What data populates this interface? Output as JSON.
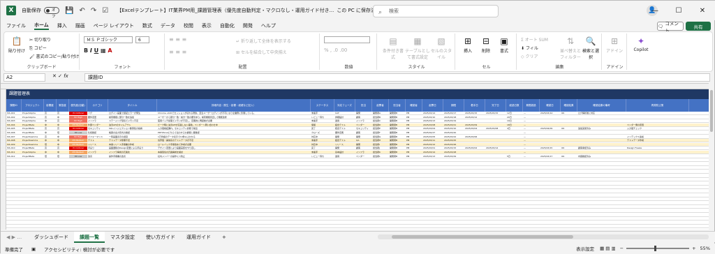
{
  "titlebar": {
    "autosave_label": "自動保存",
    "autosave_state": "オフ",
    "doc_title": "【Excelテンプレート】IT業界PM用_課題管理表（優先度自動判定・マクロなし・運用ガイド付き...",
    "save_location": "この PC に保存済み",
    "search_placeholder": "検索",
    "minimize": "—",
    "maximize": "☐",
    "close": "✕"
  },
  "menu": {
    "items": [
      "ファイル",
      "ホーム",
      "挿入",
      "描画",
      "ページ レイアウト",
      "数式",
      "データ",
      "校閲",
      "表示",
      "自動化",
      "開発",
      "ヘルプ"
    ],
    "active": "ホーム",
    "comment": "コメント",
    "share": "共有"
  },
  "ribbon": {
    "clipboard": {
      "paste": "貼り付け",
      "cut": "切り取り",
      "copy": "コピー",
      "format_painter": "書式のコピー/貼り付け",
      "label": "クリップボード"
    },
    "font": {
      "name": "ＭＳ Ｐゴシック",
      "size": "6",
      "label": "フォント"
    },
    "alignment": {
      "wrap": "折り返して全体を表示する",
      "merge": "セルを結合して中央揃え",
      "label": "配置"
    },
    "number": {
      "label": "数値"
    },
    "styles": {
      "conditional": "条件付き書式",
      "table": "テーブルとして書式設定",
      "cell": "セルのスタイル",
      "label": "スタイル"
    },
    "cells": {
      "insert": "挿入",
      "delete": "削除",
      "format": "書式",
      "label": "セル"
    },
    "editing": {
      "autosum": "オート SUM",
      "fill": "フィル",
      "clear": "クリア",
      "sort": "並べ替えとフィルター",
      "find": "検索と選択",
      "label": "編集"
    },
    "addins": {
      "label": "アドイン",
      "addin": "アドイン"
    },
    "copilot": "Copilot"
  },
  "formula": {
    "cell": "A2",
    "fx": "fx",
    "value": "課題ID"
  },
  "sheet": {
    "title": "課題管理表",
    "headers": [
      "課題ID",
      "プロジェクト",
      "影響度",
      "緊急度",
      "優先度(自動)",
      "カテゴリ",
      "タイトル",
      "詳細内容（発生・影響・経緯など記入）",
      "ステータス",
      "対応フェーズ",
      "担当",
      "起票者",
      "担当者",
      "確認者",
      "起票日",
      "期限",
      "着手日",
      "完了日",
      "経過日数",
      "期限超過",
      "確認日",
      "確認結果",
      "確認結果の備考",
      "再発防止策"
    ],
    "rows": [
      {
        "id": "ISS-001",
        "proj": "ProjectAlpha",
        "impact": "高",
        "urgency": "高",
        "prio": "P1 Critical",
        "pcolor": "#e00000",
        "cat": "バグ",
        "title": "ログイン画面で認証エラーが発生",
        "detail": "Chrome v120でセッションが切れる現象。至急ユーザーログインが不可になり全業務に影響している。",
        "status": "未着手",
        "phase": "UAT",
        "dept": "開発",
        "owner": "開発者A",
        "reporter": "開発者B",
        "checker": "PM",
        "date": "2025/03/14",
        "due": "2025/03/17",
        "start": "2025/03/15",
        "done": "2025/03/15",
        "days": "12日",
        "over": "—",
        "cdate": "2025/03/14",
        "cres": "OK",
        "cnote": "ログ解析後に対応",
        "prev": ""
      },
      {
        "id": "ISS-002",
        "proj": "ProjectAlpha",
        "impact": "高",
        "urgency": "中",
        "prio": "P2 High",
        "pcolor": "#f07060",
        "cat": "要件変更",
        "title": "検索機能に部分一致を追加",
        "detail": "ユーザーから部分一致・前方一致の要望あり。検索機能見直しで機能改修",
        "status": "レビュー待ち",
        "phase": "詳細設計",
        "dept": "顧客",
        "owner": "担当者B",
        "reporter": "開発者B",
        "checker": "PM",
        "date": "2025/03/10",
        "due": "2025/03/18",
        "start": "2025/03/12",
        "done": "",
        "days": "20日",
        "over": "—",
        "cdate": "",
        "cres": "",
        "cnote": "",
        "prev": ""
      },
      {
        "id": "ISS-003",
        "proj": "ProjectAlpha",
        "impact": "中",
        "urgency": "高",
        "prio": "P2 High",
        "pcolor": "#f07060",
        "cat": "インフラ",
        "title": "ステージング環境でメモリ不足",
        "detail": "夜間バッチ処理でメモリが不足し、定期的に再起動が必要",
        "status": "未着手",
        "phase": "運用",
        "dept": "インフラ",
        "owner": "担当者C",
        "reporter": "開発者B",
        "checker": "PM",
        "date": "2025/03/13",
        "due": "2025/03/19",
        "start": "",
        "done": "",
        "days": "19日",
        "over": "—",
        "cdate": "",
        "cres": "",
        "cnote": "",
        "prev": ""
      },
      {
        "id": "ISS-004",
        "proj": "ProjectBeta",
        "impact": "中",
        "urgency": "中",
        "prio": "P3 Medium",
        "pcolor": "#f4a460",
        "cat": "外部ベンダー",
        "title": "決済APIのタイムアウト",
        "detail": "ピーク時に決済APIが応答しない事象。ベンダーへ問い合わせ中",
        "status": "保留",
        "phase": "結合テスト",
        "dept": "ベンダー",
        "owner": "担当者D",
        "reporter": "開発者B",
        "checker": "PM",
        "date": "2025/03/08",
        "due": "2025/03/21",
        "start": "2025/03/09",
        "done": "",
        "days": "18日",
        "over": "—",
        "cdate": "",
        "cres": "",
        "cnote": "",
        "prev": "ベンダー側の原因"
      },
      {
        "id": "ISS-005",
        "proj": "ProjectBeta",
        "impact": "高",
        "urgency": "高",
        "prio": "P1 Critical",
        "pcolor": "#e00000",
        "cat": "セキュリティ",
        "title": "SQLインジェクション脆弱性の指摘",
        "detail": "入力値検証漏れ。セキュリティ診断で検出",
        "status": "完了",
        "phase": "統合テスト",
        "dept": "セキュリティ",
        "owner": "担当者E",
        "reporter": "開発者B",
        "checker": "PM",
        "date": "2025/03/04",
        "due": "2025/03/10",
        "start": "2025/03/04",
        "done": "2025/03/08",
        "days": "4日",
        "over": "—",
        "cdate": "2025/04/09",
        "cres": "OK",
        "cnote": "追加実施済み",
        "prev": "入力値チェック"
      },
      {
        "id": "ISS-006",
        "proj": "ProjectBeta",
        "impact": "中",
        "urgency": "低",
        "prio": "P4 Low",
        "pcolor": "#ccc",
        "cat": "仕様確認",
        "title": "帳票の出力形式の確認",
        "detail": "PDF/Excelどちらで出力するか顧客と要確認",
        "status": "クローズ",
        "phase": "要件定義",
        "dept": "顧客",
        "owner": "担当者F",
        "reporter": "開発者B",
        "checker": "PM",
        "date": "2025/02/27",
        "due": "2025/03/20",
        "start": "",
        "done": "",
        "days": "",
        "over": "—",
        "cdate": "",
        "cres": "",
        "cnote": "",
        "prev": ""
      },
      {
        "id": "ISS-007",
        "proj": "ProjectGamma",
        "impact": "高",
        "urgency": "中",
        "prio": "P2 High",
        "pcolor": "#f07060",
        "cat": "パフォーマンス",
        "title": "一覧画面表示の遅延",
        "detail": "1万件超のデータ表示で10秒以上かかる",
        "status": "対応中",
        "phase": "開発",
        "dept": "開発",
        "owner": "担当者G",
        "reporter": "開発者B",
        "checker": "PM",
        "date": "2025/03/05",
        "due": "2025/03/22",
        "start": "2025/03/06",
        "done": "",
        "days": "",
        "over": "—",
        "cdate": "",
        "cres": "",
        "cnote": "",
        "prev": "インデックス追加"
      },
      {
        "id": "ISS-008",
        "proj": "ProjectGamma",
        "impact": "中",
        "urgency": "中",
        "prio": "P3 Medium",
        "pcolor": "#f4a460",
        "cat": "テスト",
        "title": "テストデータ整備不足",
        "detail": "境界値・異常系のテストデータが不足",
        "status": "未着手",
        "phase": "結合テスト",
        "dept": "QA",
        "owner": "担当者H",
        "reporter": "開発者B",
        "checker": "PM",
        "date": "2025/03/11",
        "due": "2025/03/25",
        "start": "",
        "done": "",
        "days": "",
        "over": "—",
        "cdate": "",
        "cres": "",
        "cnote": "",
        "prev": "テストデータ作成"
      },
      {
        "id": "ISS-009",
        "proj": "ProjectGamma",
        "impact": "低",
        "urgency": "中",
        "prio": "P3 Medium",
        "pcolor": "#f4a460",
        "cat": "リリース",
        "title": "本番リリース手順書の作成",
        "detail": "ロールバック手順含めて作成が必要",
        "status": "対応中",
        "phase": "リリース",
        "dept": "開発",
        "owner": "担当者I",
        "reporter": "開発者B",
        "checker": "PM",
        "date": "2025/03/12",
        "due": "2025/03/26",
        "start": "",
        "done": "",
        "days": "",
        "over": "—",
        "cdate": "",
        "cres": "",
        "cnote": "",
        "prev": ""
      },
      {
        "id": "ISS-010",
        "proj": "ProjectBeta",
        "impact": "高",
        "urgency": "高",
        "prio": "P1 Critical",
        "pcolor": "#e00000",
        "cat": "手戻り",
        "title": "画面遷移のDesign変更による手戻り",
        "detail": "デザイン変更により画面実装をやり直し",
        "status": "完了",
        "phase": "開発",
        "dept": "顧客",
        "owner": "担当者J",
        "reporter": "開発者B",
        "checker": "PM",
        "date": "2025/03/01",
        "due": "2025/03/15",
        "start": "2025/03/02",
        "done": "2025/03/14",
        "days": "",
        "over": "—",
        "cdate": "2025/03/15",
        "cres": "OK",
        "cnote": "顧客承認済み",
        "prev": "Design Freeze"
      },
      {
        "id": "ISS-011",
        "proj": "ProjectAlpha",
        "impact": "中",
        "urgency": "中",
        "prio": "P3 Medium",
        "pcolor": "#f4a460",
        "cat": "インフラ",
        "title": "インフラ構成の冗長化",
        "detail": "本番環境の冗長構成を検討",
        "status": "未着手",
        "phase": "基本設計",
        "dept": "インフラ",
        "owner": "担当者K",
        "reporter": "開発者B",
        "checker": "PM",
        "date": "2025/03/14",
        "due": "2025/03/28",
        "start": "",
        "done": "",
        "days": "",
        "over": "—",
        "cdate": "",
        "cres": "",
        "cnote": "",
        "prev": ""
      },
      {
        "id": "ISS-012",
        "proj": "ProjectBeta",
        "impact": "低",
        "urgency": "低",
        "prio": "P4 Low",
        "pcolor": "#ccc",
        "cat": "改善",
        "title": "操作手順書の改善",
        "detail": "社内メンバーの操作ミス防止",
        "status": "レビュー待ち",
        "phase": "運用",
        "dept": "ベンダー",
        "owner": "担当者L",
        "reporter": "開発者B",
        "checker": "PM",
        "date": "2025/03/13",
        "due": "2025/03/29",
        "start": "",
        "done": "",
        "days": "5日",
        "over": "—",
        "cdate": "2025/03/17",
        "cres": "OK",
        "cnote": "内容確認済み",
        "prev": ""
      }
    ]
  },
  "tabs": {
    "items": [
      "ダッシュボード",
      "課題一覧",
      "マスタ設定",
      "使い方ガイド",
      "運用ガイド"
    ],
    "active": "課題一覧",
    "add": "+"
  },
  "status": {
    "ready": "準備完了",
    "accessibility": "アクセシビリティ: 検討が必要です",
    "display": "表示設定",
    "zoom": "55%"
  }
}
